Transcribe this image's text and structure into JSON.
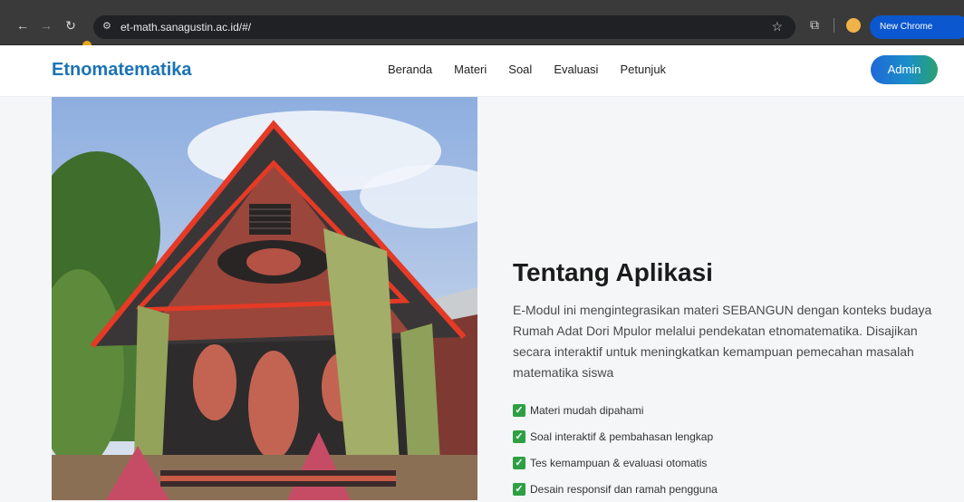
{
  "browser": {
    "url": "et-math.sanagustin.ac.id/#/",
    "update_label": "New Chrome available"
  },
  "site": {
    "brand": "Etnomatematika",
    "nav": [
      "Beranda",
      "Materi",
      "Soal",
      "Evaluasi",
      "Petunjuk"
    ],
    "admin_label": "Admin"
  },
  "about": {
    "title": "Tentang Aplikasi",
    "description": "E-Modul ini mengintegrasikan materi SEBANGUN dengan konteks budaya Rumah Adat Dori Mpulor melalui pendekatan etnomatematika. Disajikan secara interaktif untuk meningkatkan kemampuan pemecahan masalah matematika siswa",
    "features": [
      "Materi mudah dipahami",
      "Soal interaktif & pembahasan lengkap",
      "Tes kemampuan & evaluasi otomatis",
      "Desain responsif dan ramah pengguna"
    ]
  },
  "colors": {
    "brand": "#1b73b5",
    "check": "#2ea043",
    "chrome_bg": "#3a3a3a",
    "update_pill": "#0b57d0"
  }
}
